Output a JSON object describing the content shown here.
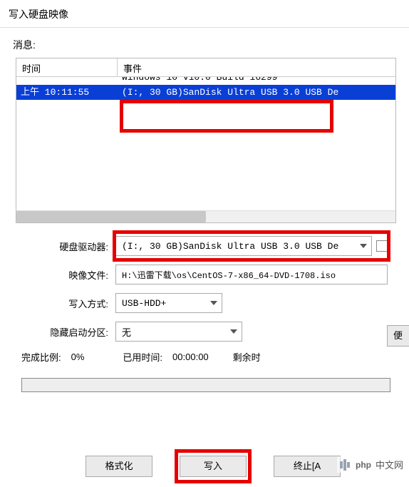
{
  "window_title": "写入硬盘映像",
  "info_label": "消息:",
  "log": {
    "headers": {
      "time": "时间",
      "event": "事件"
    },
    "rows": [
      {
        "time": "",
        "event": "Windows 10 v10.0 Build 16299"
      },
      {
        "time": "上午 10:11:55",
        "event": "(I:, 30 GB)SanDisk Ultra USB 3.0 USB De",
        "selected": true
      }
    ]
  },
  "fields": {
    "drive": {
      "label": "硬盘驱动器:",
      "value": "(I:, 30 GB)SanDisk Ultra USB 3.0 USB De"
    },
    "image": {
      "label": "映像文件:",
      "value": "H:\\迅雷下载\\os\\CentOS-7-x86_64-DVD-1708.iso"
    },
    "write": {
      "label": "写入方式:",
      "value": "USB-HDD+"
    },
    "hidden": {
      "label": "隐藏启动分区:",
      "value": "无"
    }
  },
  "stats": {
    "done_label": "完成比例:",
    "done_value": "0%",
    "used_label": "已用时间:",
    "used_value": "00:00:00",
    "remain_label": "剩余时"
  },
  "side_button": "便",
  "buttons": {
    "format": "格式化",
    "write": "写入",
    "abort": "终止[A"
  },
  "watermark": "中文网",
  "watermark_php": "php"
}
